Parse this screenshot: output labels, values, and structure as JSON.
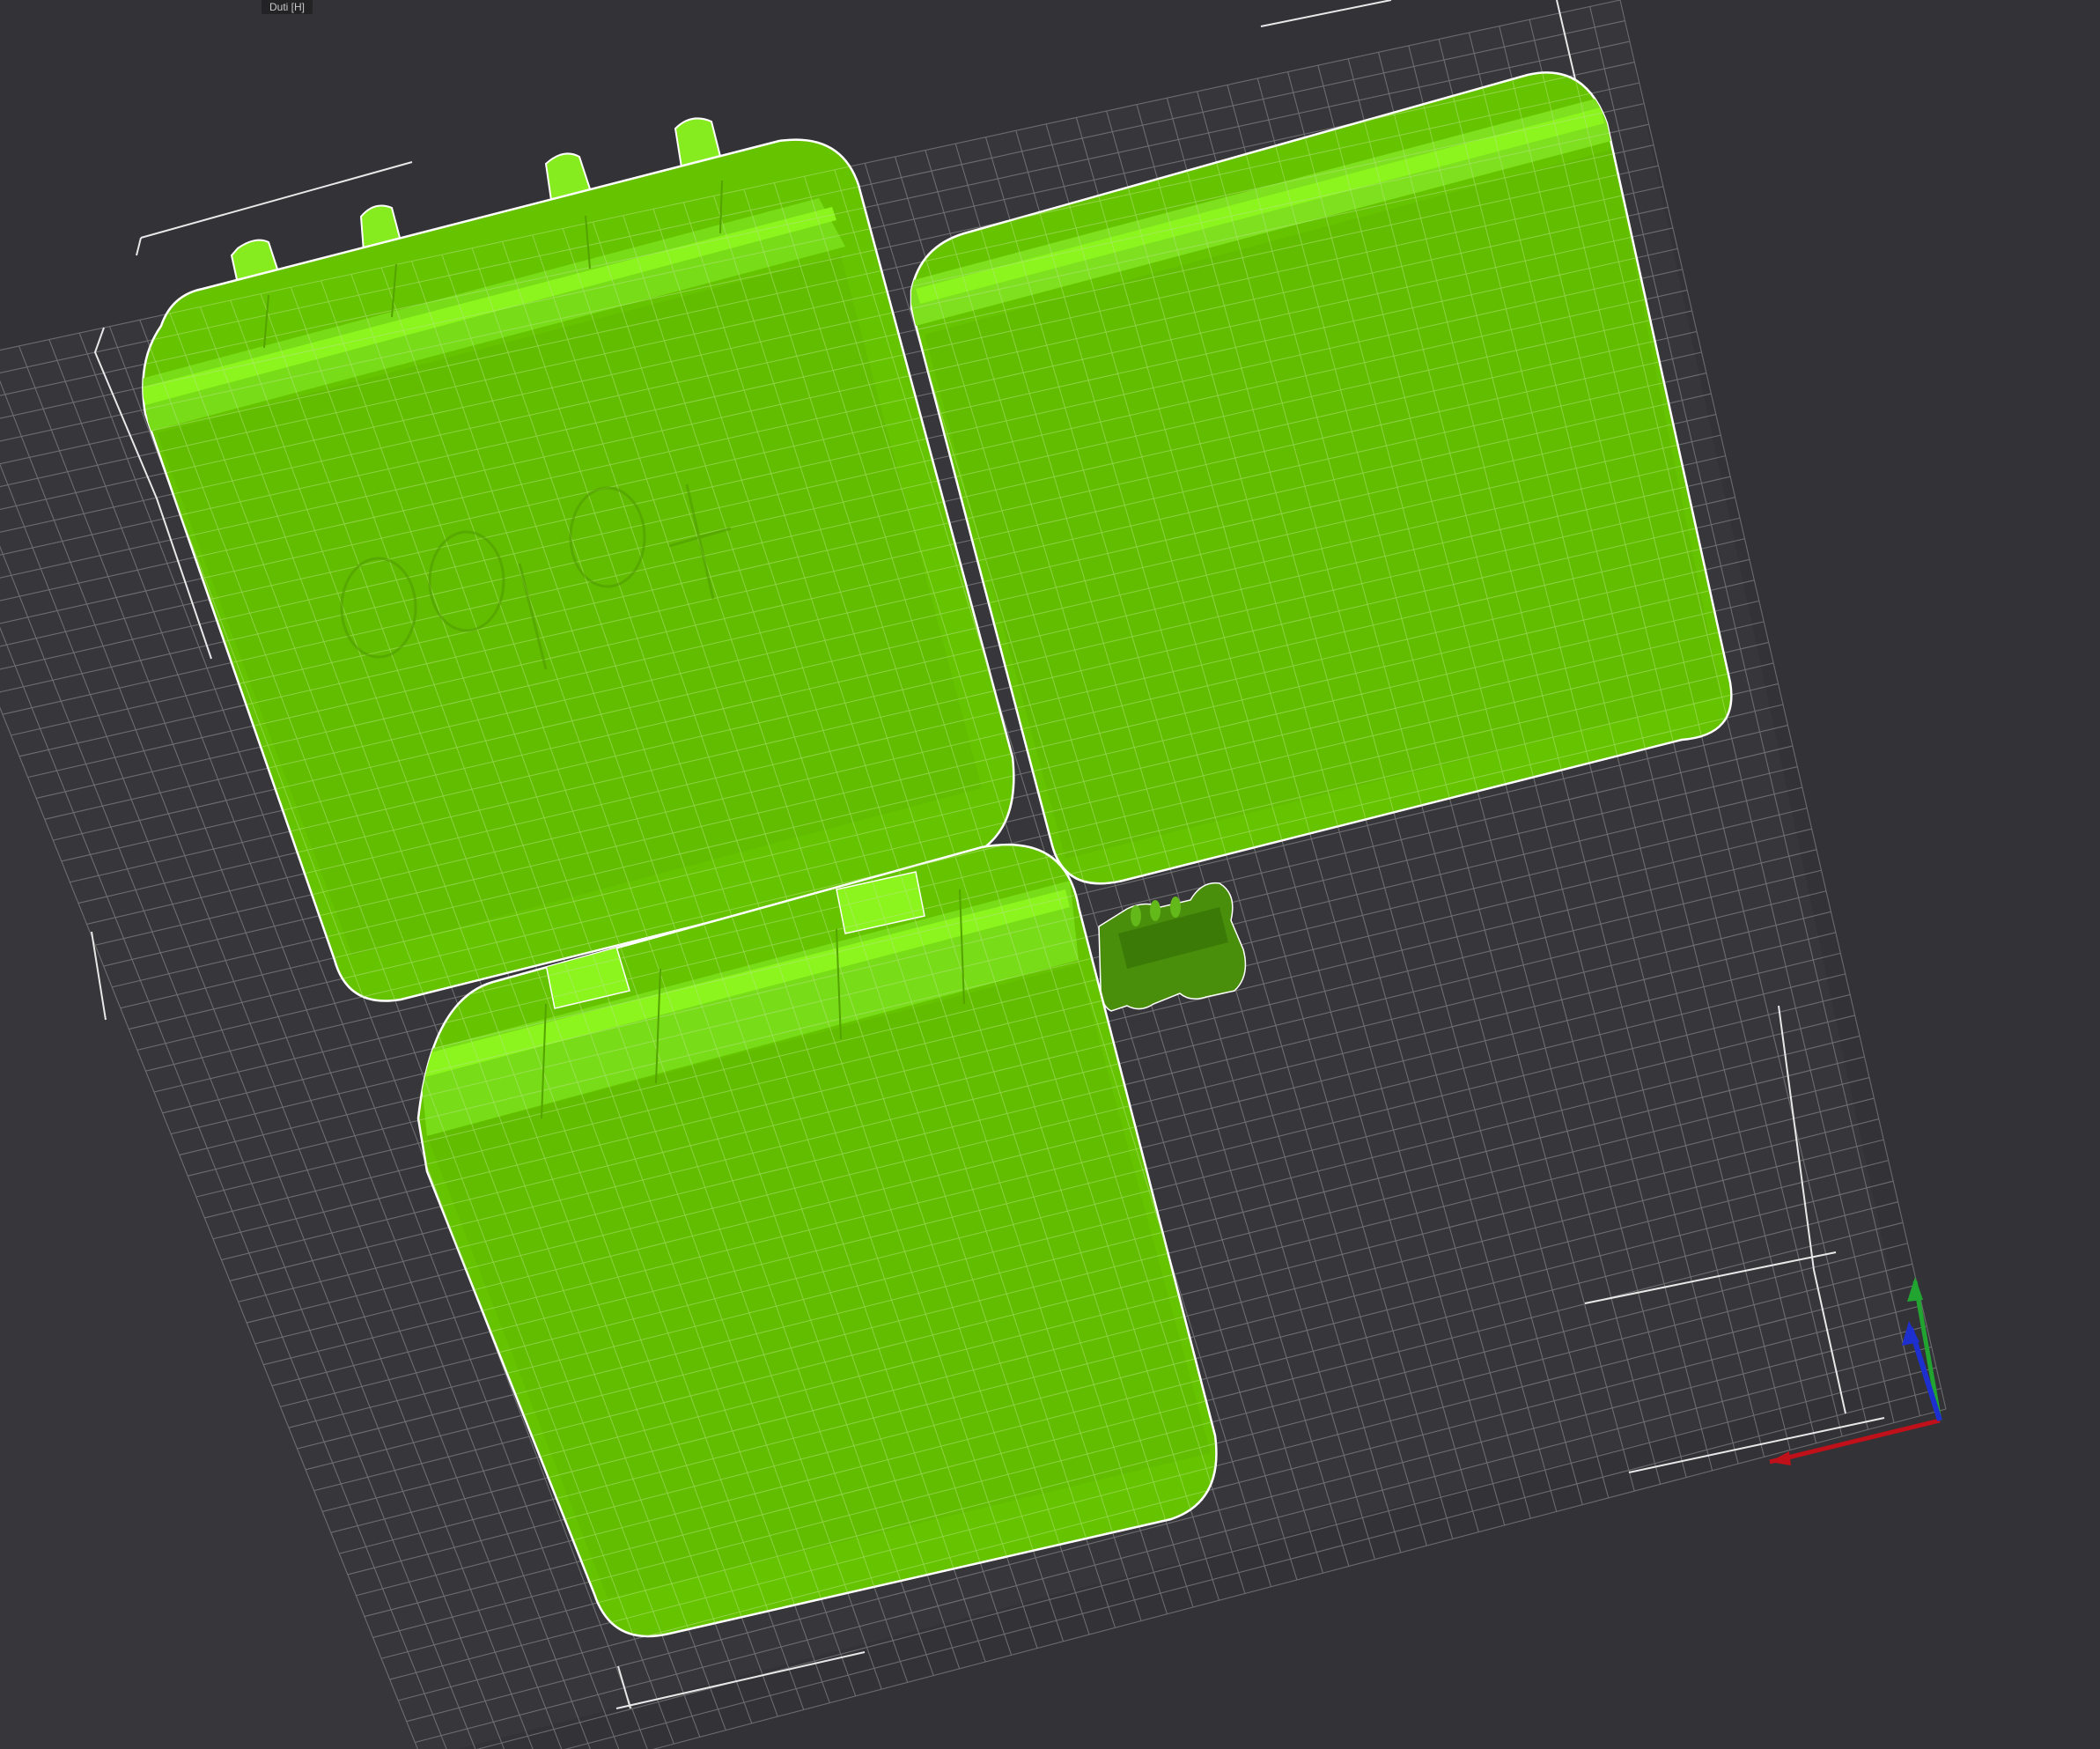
{
  "tooltip": {
    "text": "Duti [H]"
  },
  "viewport": {
    "background_color": "#333337",
    "plate_grid_color": "#9a9a9a",
    "plate_border_color": "#e8e8e8",
    "model_color": "#66c300",
    "model_top_color": "#7ee01e",
    "model_rim_color": "#8cf51e",
    "model_shadow_color": "#3f7d0a",
    "model_outline_color": "#ffffff",
    "models": [
      {
        "name": "case-body-part",
        "kind": "box-with-hinges"
      },
      {
        "name": "case-lid-part",
        "kind": "box"
      },
      {
        "name": "case-body-part-2",
        "kind": "box-with-hinges"
      },
      {
        "name": "hinge-pin-part",
        "kind": "pin"
      }
    ]
  },
  "axes": {
    "x_color": "#c0101a",
    "y_color": "#22a530",
    "z_color": "#1e2fd0"
  }
}
